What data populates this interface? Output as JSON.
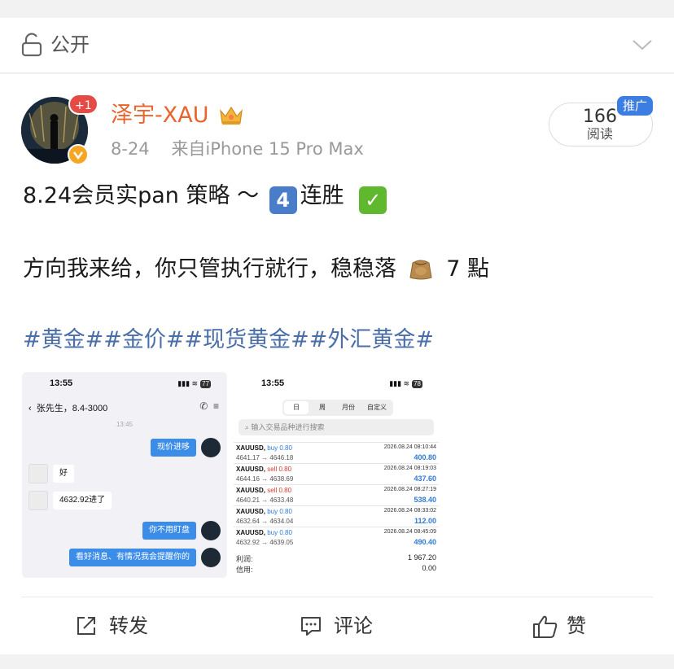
{
  "visibility": {
    "label": "公开"
  },
  "author": {
    "name": "泽宇-XAU",
    "notification_badge": "+1",
    "date": "8-24",
    "source": "来自iPhone 15 Pro Max"
  },
  "reads": {
    "count": "166",
    "label": "阅读",
    "promo_tag": "推广"
  },
  "post": {
    "line1_text": "8.24会员实pan 策略 ～",
    "line1_emoji_number": "4",
    "line1_end": "连胜",
    "line2_text": "方向我来给，你只管执行就行，稳稳落",
    "line2_end": "7 點",
    "hashtags": "#黄金##金价##现货黄金##外汇黄金#"
  },
  "chat_shot": {
    "time": "13:55",
    "battery": "77",
    "contact": "张先生，8.4-3000",
    "timestamp": "13:45",
    "messages": [
      {
        "side": "right",
        "text": "现价进哆"
      },
      {
        "side": "left",
        "text": "好"
      },
      {
        "side": "left",
        "text": "4632.92进了"
      },
      {
        "side": "right",
        "text": "你不用盯盘"
      },
      {
        "side": "right",
        "text": "看好消息、有情况我会提醒你的"
      }
    ]
  },
  "trade_shot": {
    "time": "13:55",
    "battery": "78",
    "tabs": [
      "日",
      "周",
      "月份",
      "自定义"
    ],
    "active_tab": "日",
    "search_placeholder": "输入交易品种进行搜索",
    "trades": [
      {
        "symbol": "XAUUSD,",
        "side": "buy 0.80",
        "date": "2026.08.24 08:10:44",
        "prices": "4641.17 → 4646.18",
        "profit": "400.80"
      },
      {
        "symbol": "XAUUSD,",
        "side": "sell 0.80",
        "date": "2026.08.24 08:19:03",
        "prices": "4644.16 → 4638.69",
        "profit": "437.60"
      },
      {
        "symbol": "XAUUSD,",
        "side": "sell 0.80",
        "date": "2026.08.24 08:27:19",
        "prices": "4640.21 → 4633.48",
        "profit": "538.40"
      },
      {
        "symbol": "XAUUSD,",
        "side": "buy 0.80",
        "date": "2026.08.24 08:33:02",
        "prices": "4632.64 → 4634.04",
        "profit": "112.00"
      },
      {
        "symbol": "XAUUSD,",
        "side": "buy 0.80",
        "date": "2026.08.24 08:45:09",
        "prices": "4632.92 → 4639.05",
        "profit": "490.40"
      }
    ],
    "summary": [
      {
        "label": "利润:",
        "value": "1 967.20"
      },
      {
        "label": "信用:",
        "value": "0.00"
      }
    ]
  },
  "actions": {
    "share": "转发",
    "comment": "评论",
    "like": "赞"
  },
  "colors": {
    "username": "#e8642c",
    "hashtag": "#4a6ea9",
    "promo": "#3b7de0",
    "buy": "#2e7ad8",
    "sell": "#d9382c"
  },
  "icons": [
    "lock-icon",
    "chevron-down-icon",
    "crown-icon",
    "verified-icon",
    "money-bag-icon",
    "share-icon",
    "comment-icon",
    "like-icon"
  ]
}
